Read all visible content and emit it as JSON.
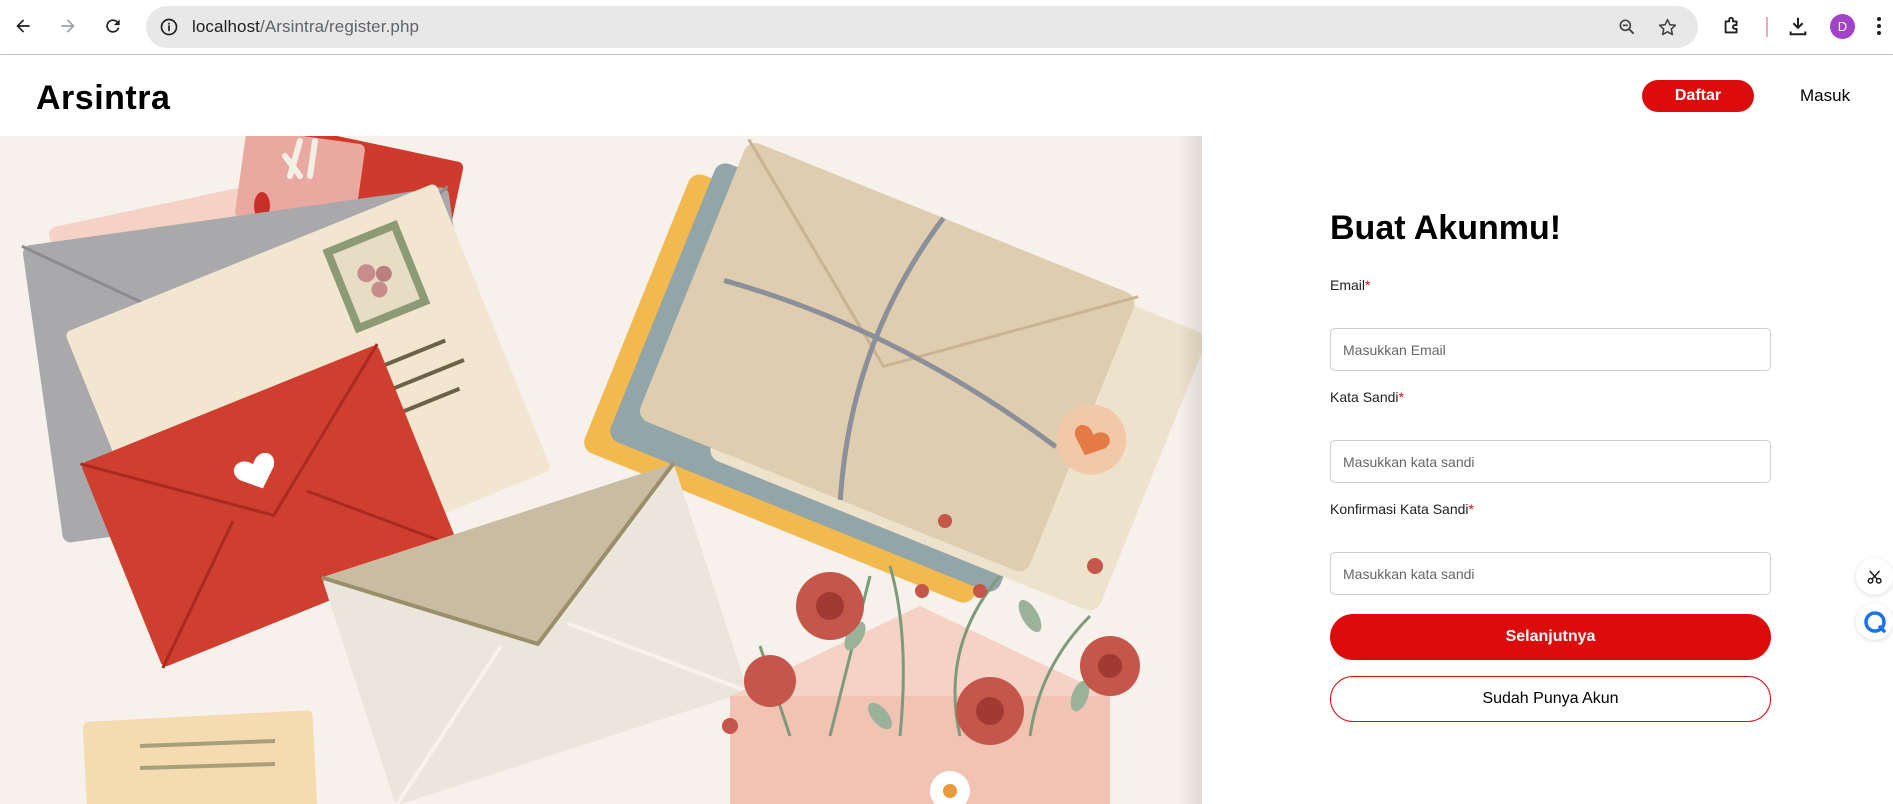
{
  "browser": {
    "url_host": "localhost",
    "url_path": "/Arsintra/register.php",
    "profile_initial": "D"
  },
  "header": {
    "logo": "Arsintra",
    "register_label": "Daftar",
    "login_label": "Masuk"
  },
  "form": {
    "title": "Buat Akunmu!",
    "email_label": "Email",
    "email_placeholder": "Masukkan Email",
    "password_label": "Kata Sandi",
    "password_placeholder": "Masukkan kata sandi",
    "confirm_label": "Konfirmasi Kata Sandi",
    "confirm_placeholder": "Masukkan kata sandi",
    "required_mark": "*",
    "next_label": "Selanjutnya",
    "have_account_label": "Sudah Punya Akun"
  },
  "colors": {
    "brand_red": "#dc0c0c",
    "avatar": "#a142c9"
  }
}
